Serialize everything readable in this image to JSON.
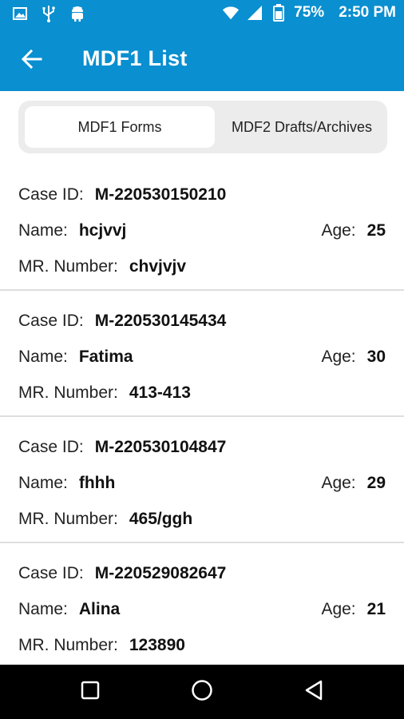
{
  "status_bar": {
    "battery_percent": "75%",
    "time": "2:50 PM",
    "left_icons": [
      "image-icon",
      "usb-icon",
      "android-icon"
    ],
    "right_icons": [
      "wifi-icon",
      "signal-icon",
      "battery-icon"
    ]
  },
  "toolbar": {
    "title": "MDF1 List",
    "back_icon": "arrow-left-icon"
  },
  "tabs": [
    {
      "label": "MDF1 Forms",
      "active": true
    },
    {
      "label": "MDF2 Drafts/Archives",
      "active": false
    }
  ],
  "labels": {
    "case_id": "Case ID:",
    "name": "Name:",
    "age": "Age:",
    "mr_number": "MR. Number:"
  },
  "records": [
    {
      "case_id": "M-220530150210",
      "name": "hcjvvj",
      "age": "25",
      "mr_number": "chvjvjv"
    },
    {
      "case_id": "M-220530145434",
      "name": "Fatima",
      "age": "30",
      "mr_number": "413-413"
    },
    {
      "case_id": "M-220530104847",
      "name": "fhhh",
      "age": "29",
      "mr_number": "465/ggh"
    },
    {
      "case_id": "M-220529082647",
      "name": "Alina",
      "age": "21",
      "mr_number": "123890"
    }
  ],
  "nav_bar": {
    "icons": [
      "recents-square-icon",
      "home-circle-icon",
      "back-triangle-icon"
    ]
  },
  "colors": {
    "app_bar": "#0a8fd0",
    "nav_bar": "#000000",
    "tab_bg": "#ececec"
  }
}
